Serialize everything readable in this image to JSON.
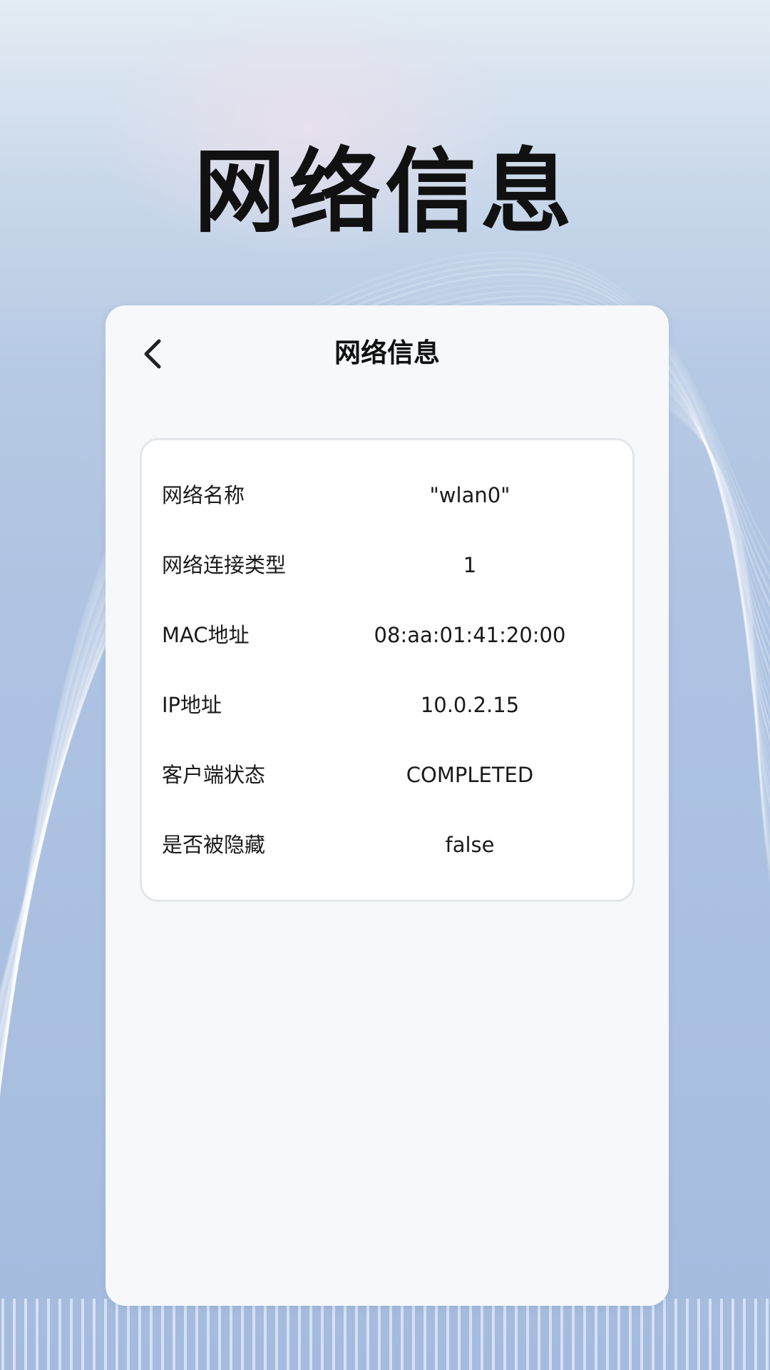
{
  "hero": {
    "title": "网络信息"
  },
  "header": {
    "back_icon": "chevron-left-icon",
    "title": "网络信息"
  },
  "network_info": {
    "rows": [
      {
        "label": "网络名称",
        "value": "\"wlan0\""
      },
      {
        "label": "网络连接类型",
        "value": "1"
      },
      {
        "label": "MAC地址",
        "value": "08:aa:01:41:20:00"
      },
      {
        "label": "IP地址",
        "value": "10.0.2.15"
      },
      {
        "label": "客户端状态",
        "value": "COMPLETED"
      },
      {
        "label": "是否被隐藏",
        "value": "false"
      }
    ]
  },
  "colors": {
    "panel_background": "#f6f8fa",
    "card_background": "#ffffff",
    "text": "#1a1a1a"
  }
}
